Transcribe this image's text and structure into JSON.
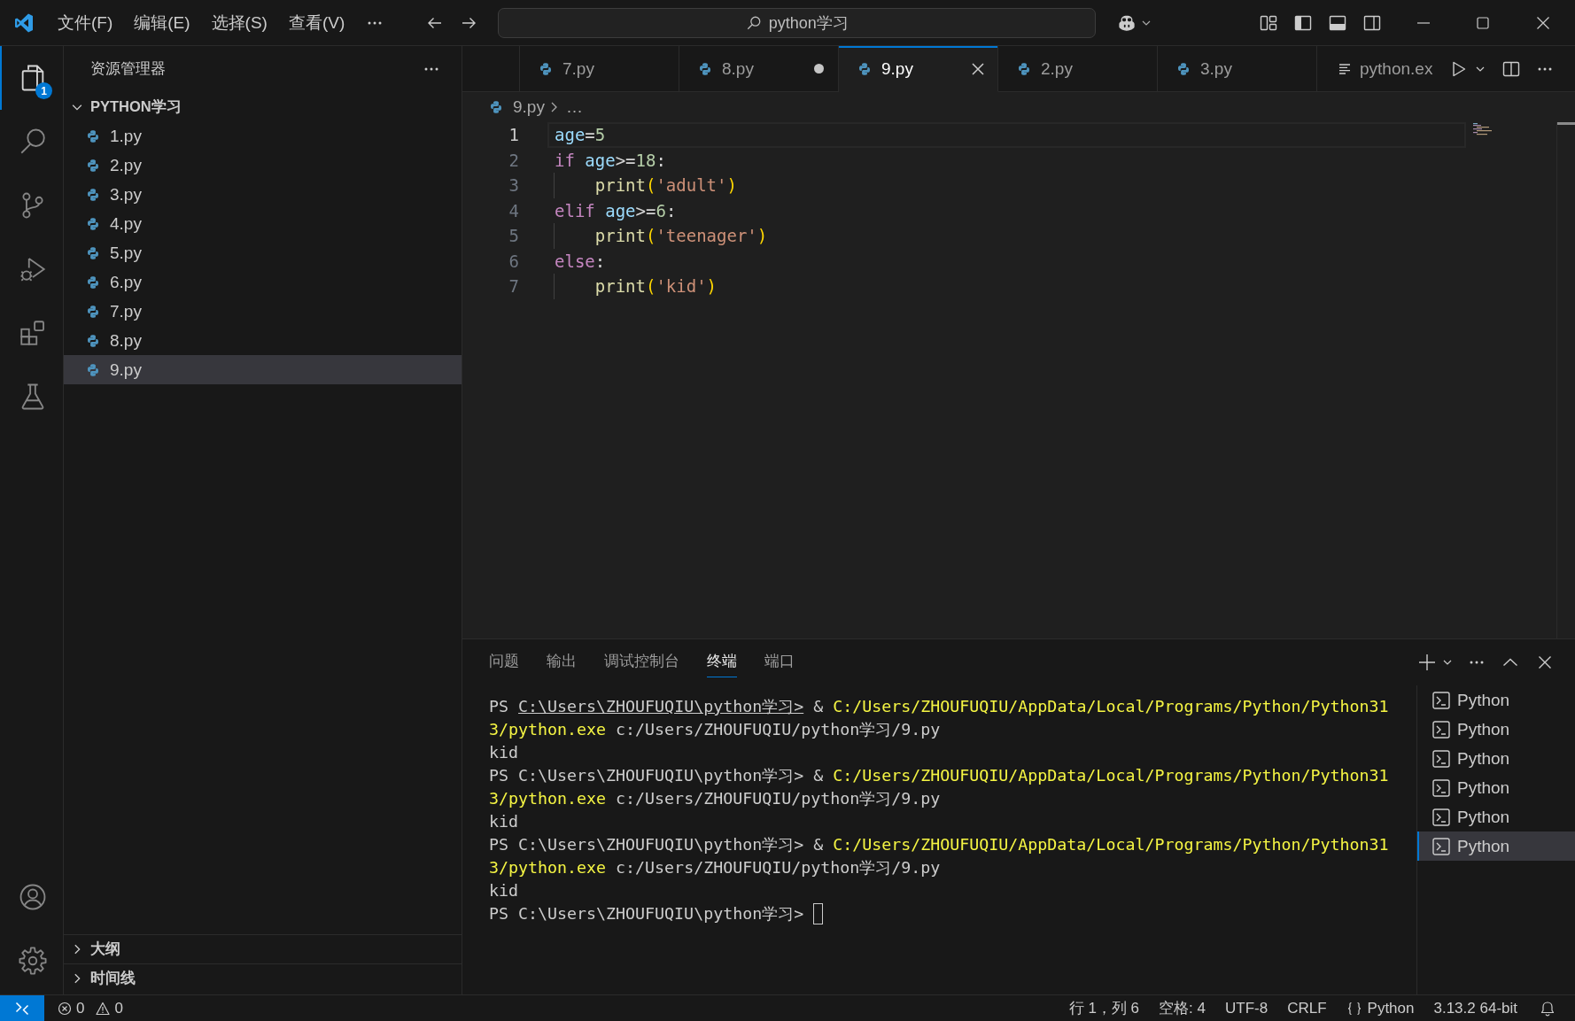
{
  "title_bar": {
    "menus": [
      "文件(F)",
      "编辑(E)",
      "选择(S)",
      "查看(V)"
    ],
    "command_center": {
      "label": "python学习"
    }
  },
  "activity_bar": {
    "items": [
      {
        "kind": "files",
        "selected": true,
        "badge": "1"
      },
      {
        "kind": "search",
        "selected": false
      },
      {
        "kind": "branch",
        "selected": false
      },
      {
        "kind": "run-debug",
        "selected": false
      },
      {
        "kind": "extensions",
        "selected": false
      },
      {
        "kind": "flask",
        "selected": false
      }
    ],
    "bottom": [
      {
        "kind": "account"
      },
      {
        "kind": "settings"
      }
    ]
  },
  "explorer": {
    "title": "资源管理器",
    "folder": {
      "label": "PYTHON学习",
      "expanded": true,
      "children": [
        {
          "label": "1.py",
          "selected": false
        },
        {
          "label": "2.py",
          "selected": false
        },
        {
          "label": "3.py",
          "selected": false
        },
        {
          "label": "4.py",
          "selected": false
        },
        {
          "label": "5.py",
          "selected": false
        },
        {
          "label": "6.py",
          "selected": false
        },
        {
          "label": "7.py",
          "selected": false
        },
        {
          "label": "8.py",
          "selected": false
        },
        {
          "label": "9.py",
          "selected": true
        }
      ]
    },
    "sections": [
      {
        "label": "大纲",
        "expanded": false
      },
      {
        "label": "时间线",
        "expanded": false
      }
    ]
  },
  "editor": {
    "tabs": [
      {
        "kind": "python",
        "label": "7.py",
        "selected": false,
        "dirty": false
      },
      {
        "kind": "python",
        "label": "8.py",
        "selected": false,
        "dirty": true
      },
      {
        "kind": "python",
        "label": "9.py",
        "selected": true,
        "dirty": false
      },
      {
        "kind": "python",
        "label": "2.py",
        "selected": false,
        "dirty": false
      },
      {
        "kind": "python",
        "label": "3.py",
        "selected": false,
        "dirty": false
      },
      {
        "kind": "output",
        "label": "python.ex",
        "selected": false,
        "dirty": false
      }
    ],
    "breadcrumb": {
      "file": "9.py",
      "symbol": "…"
    },
    "lines": [
      {
        "number": "1",
        "current": true,
        "guide": false,
        "tokens": [
          {
            "kind": "variable",
            "text": "age"
          },
          {
            "kind": "operator",
            "text": "="
          },
          {
            "kind": "number",
            "text": "5"
          }
        ]
      },
      {
        "number": "2",
        "current": false,
        "guide": false,
        "tokens": [
          {
            "kind": "keyword",
            "text": "if "
          },
          {
            "kind": "variable",
            "text": "age"
          },
          {
            "kind": "operator",
            "text": ">="
          },
          {
            "kind": "number",
            "text": "18"
          },
          {
            "kind": "plain",
            "text": ":"
          }
        ]
      },
      {
        "number": "3",
        "current": false,
        "guide": true,
        "tokens": [
          {
            "kind": "function",
            "text": "    print"
          },
          {
            "kind": "bracket",
            "text": "("
          },
          {
            "kind": "string",
            "text": "'adult'"
          },
          {
            "kind": "bracket",
            "text": ")"
          }
        ]
      },
      {
        "number": "4",
        "current": false,
        "guide": false,
        "tokens": [
          {
            "kind": "keyword",
            "text": "elif "
          },
          {
            "kind": "variable",
            "text": "age"
          },
          {
            "kind": "operator",
            "text": ">="
          },
          {
            "kind": "number",
            "text": "6"
          },
          {
            "kind": "plain",
            "text": ":"
          }
        ]
      },
      {
        "number": "5",
        "current": false,
        "guide": true,
        "tokens": [
          {
            "kind": "function",
            "text": "    print"
          },
          {
            "kind": "bracket",
            "text": "("
          },
          {
            "kind": "string",
            "text": "'teenager'"
          },
          {
            "kind": "bracket",
            "text": ")"
          }
        ]
      },
      {
        "number": "6",
        "current": false,
        "guide": false,
        "tokens": [
          {
            "kind": "keyword",
            "text": "else"
          },
          {
            "kind": "plain",
            "text": ":"
          }
        ]
      },
      {
        "number": "7",
        "current": false,
        "guide": true,
        "tokens": [
          {
            "kind": "function",
            "text": "    print"
          },
          {
            "kind": "bracket",
            "text": "("
          },
          {
            "kind": "string",
            "text": "'kid'"
          },
          {
            "kind": "bracket",
            "text": ")"
          }
        ]
      }
    ]
  },
  "panel": {
    "tabs": [
      {
        "label": "问题",
        "selected": false
      },
      {
        "label": "输出",
        "selected": false
      },
      {
        "label": "调试控制台",
        "selected": false
      },
      {
        "label": "终端",
        "selected": true
      },
      {
        "label": "端口",
        "selected": false
      }
    ],
    "terminal": {
      "cursor": true,
      "lines": [
        [
          {
            "kind": "plain",
            "text": "PS "
          },
          {
            "kind": "link",
            "text": "C:\\Users\\ZHOUFUQIU\\python学习>"
          },
          {
            "kind": "plain",
            "text": " & "
          },
          {
            "kind": "command",
            "text": "C:/Users/ZHOUFUQIU/AppData/Local/Programs/Python/Python31"
          }
        ],
        [
          {
            "kind": "command",
            "text": "3/python.exe"
          },
          {
            "kind": "plain",
            "text": " c:/Users/ZHOUFUQIU/python学习/9.py"
          }
        ],
        [
          {
            "kind": "plain",
            "text": "kid"
          }
        ],
        [
          {
            "kind": "plain",
            "text": "PS C:\\Users\\ZHOUFUQIU\\python学习> & "
          },
          {
            "kind": "command",
            "text": "C:/Users/ZHOUFUQIU/AppData/Local/Programs/Python/Python31"
          }
        ],
        [
          {
            "kind": "command",
            "text": "3/python.exe"
          },
          {
            "kind": "plain",
            "text": " c:/Users/ZHOUFUQIU/python学习/9.py"
          }
        ],
        [
          {
            "kind": "plain",
            "text": "kid"
          }
        ],
        [
          {
            "kind": "plain",
            "text": "PS C:\\Users\\ZHOUFUQIU\\python学习> & "
          },
          {
            "kind": "command",
            "text": "C:/Users/ZHOUFUQIU/AppData/Local/Programs/Python/Python31"
          }
        ],
        [
          {
            "kind": "command",
            "text": "3/python.exe"
          },
          {
            "kind": "plain",
            "text": " c:/Users/ZHOUFUQIU/python学习/9.py"
          }
        ],
        [
          {
            "kind": "plain",
            "text": "kid"
          }
        ],
        [
          {
            "kind": "plain",
            "text": "PS C:\\Users\\ZHOUFUQIU\\python学习>"
          }
        ]
      ]
    },
    "sessions": [
      {
        "label": "Python",
        "selected": false
      },
      {
        "label": "Python",
        "selected": false
      },
      {
        "label": "Python",
        "selected": false
      },
      {
        "label": "Python",
        "selected": false
      },
      {
        "label": "Python",
        "selected": false
      },
      {
        "label": "Python",
        "selected": true
      }
    ]
  },
  "status_bar": {
    "errors": "0",
    "warnings": "0",
    "items": [
      {
        "kind": "text",
        "text": "行 1，列 6"
      },
      {
        "kind": "text",
        "text": "空格: 4"
      },
      {
        "kind": "text",
        "text": "UTF-8"
      },
      {
        "kind": "text",
        "text": "CRLF"
      },
      {
        "kind": "language",
        "text": "Python"
      },
      {
        "kind": "text",
        "text": "3.13.2 64-bit"
      }
    ]
  }
}
